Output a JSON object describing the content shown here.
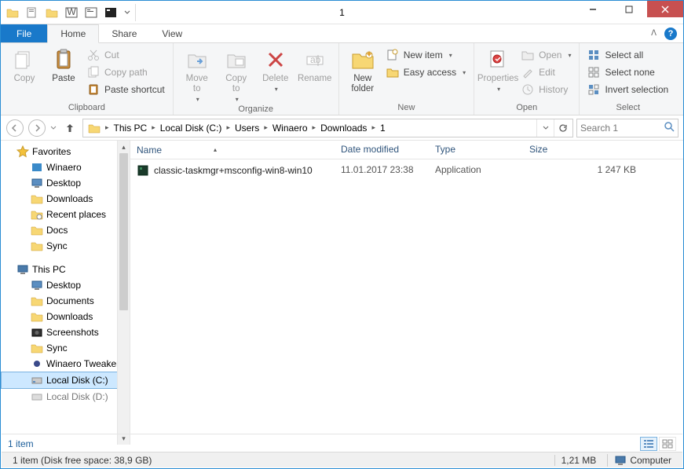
{
  "window": {
    "title": "1"
  },
  "tabs": {
    "file": "File",
    "home": "Home",
    "share": "Share",
    "view": "View"
  },
  "ribbon": {
    "clipboard": {
      "label": "Clipboard",
      "copy": "Copy",
      "paste": "Paste",
      "cut": "Cut",
      "copy_path": "Copy path",
      "paste_shortcut": "Paste shortcut"
    },
    "organize": {
      "label": "Organize",
      "move_to": "Move\nto",
      "copy_to": "Copy\nto",
      "delete": "Delete",
      "rename": "Rename"
    },
    "new": {
      "label": "New",
      "new_folder": "New\nfolder",
      "new_item": "New item",
      "easy_access": "Easy access"
    },
    "open": {
      "label": "Open",
      "properties": "Properties",
      "open": "Open",
      "edit": "Edit",
      "history": "History"
    },
    "select": {
      "label": "Select",
      "select_all": "Select all",
      "select_none": "Select none",
      "invert": "Invert selection"
    }
  },
  "breadcrumb": [
    "This PC",
    "Local Disk (C:)",
    "Users",
    "Winaero",
    "Downloads",
    "1"
  ],
  "search": {
    "placeholder": "Search 1"
  },
  "tree": {
    "favorites": "Favorites",
    "fav_items": [
      "Winaero",
      "Desktop",
      "Downloads",
      "Recent places",
      "Docs",
      "Sync"
    ],
    "this_pc": "This PC",
    "pc_items": [
      "Desktop",
      "Documents",
      "Downloads",
      "Screenshots",
      "Sync",
      "Winaero Tweaker",
      "Local Disk (C:)",
      "Local Disk (D:)"
    ]
  },
  "columns": {
    "name": "Name",
    "date": "Date modified",
    "type": "Type",
    "size": "Size"
  },
  "files": [
    {
      "name": "classic-taskmgr+msconfig-win8-win10",
      "date": "11.01.2017 23:38",
      "type": "Application",
      "size": "1 247 KB"
    }
  ],
  "infobar": {
    "count": "1 item"
  },
  "statusbar": {
    "left": "1 item (Disk free space: 38,9 GB)",
    "size": "1,21 MB",
    "computer": "Computer"
  }
}
